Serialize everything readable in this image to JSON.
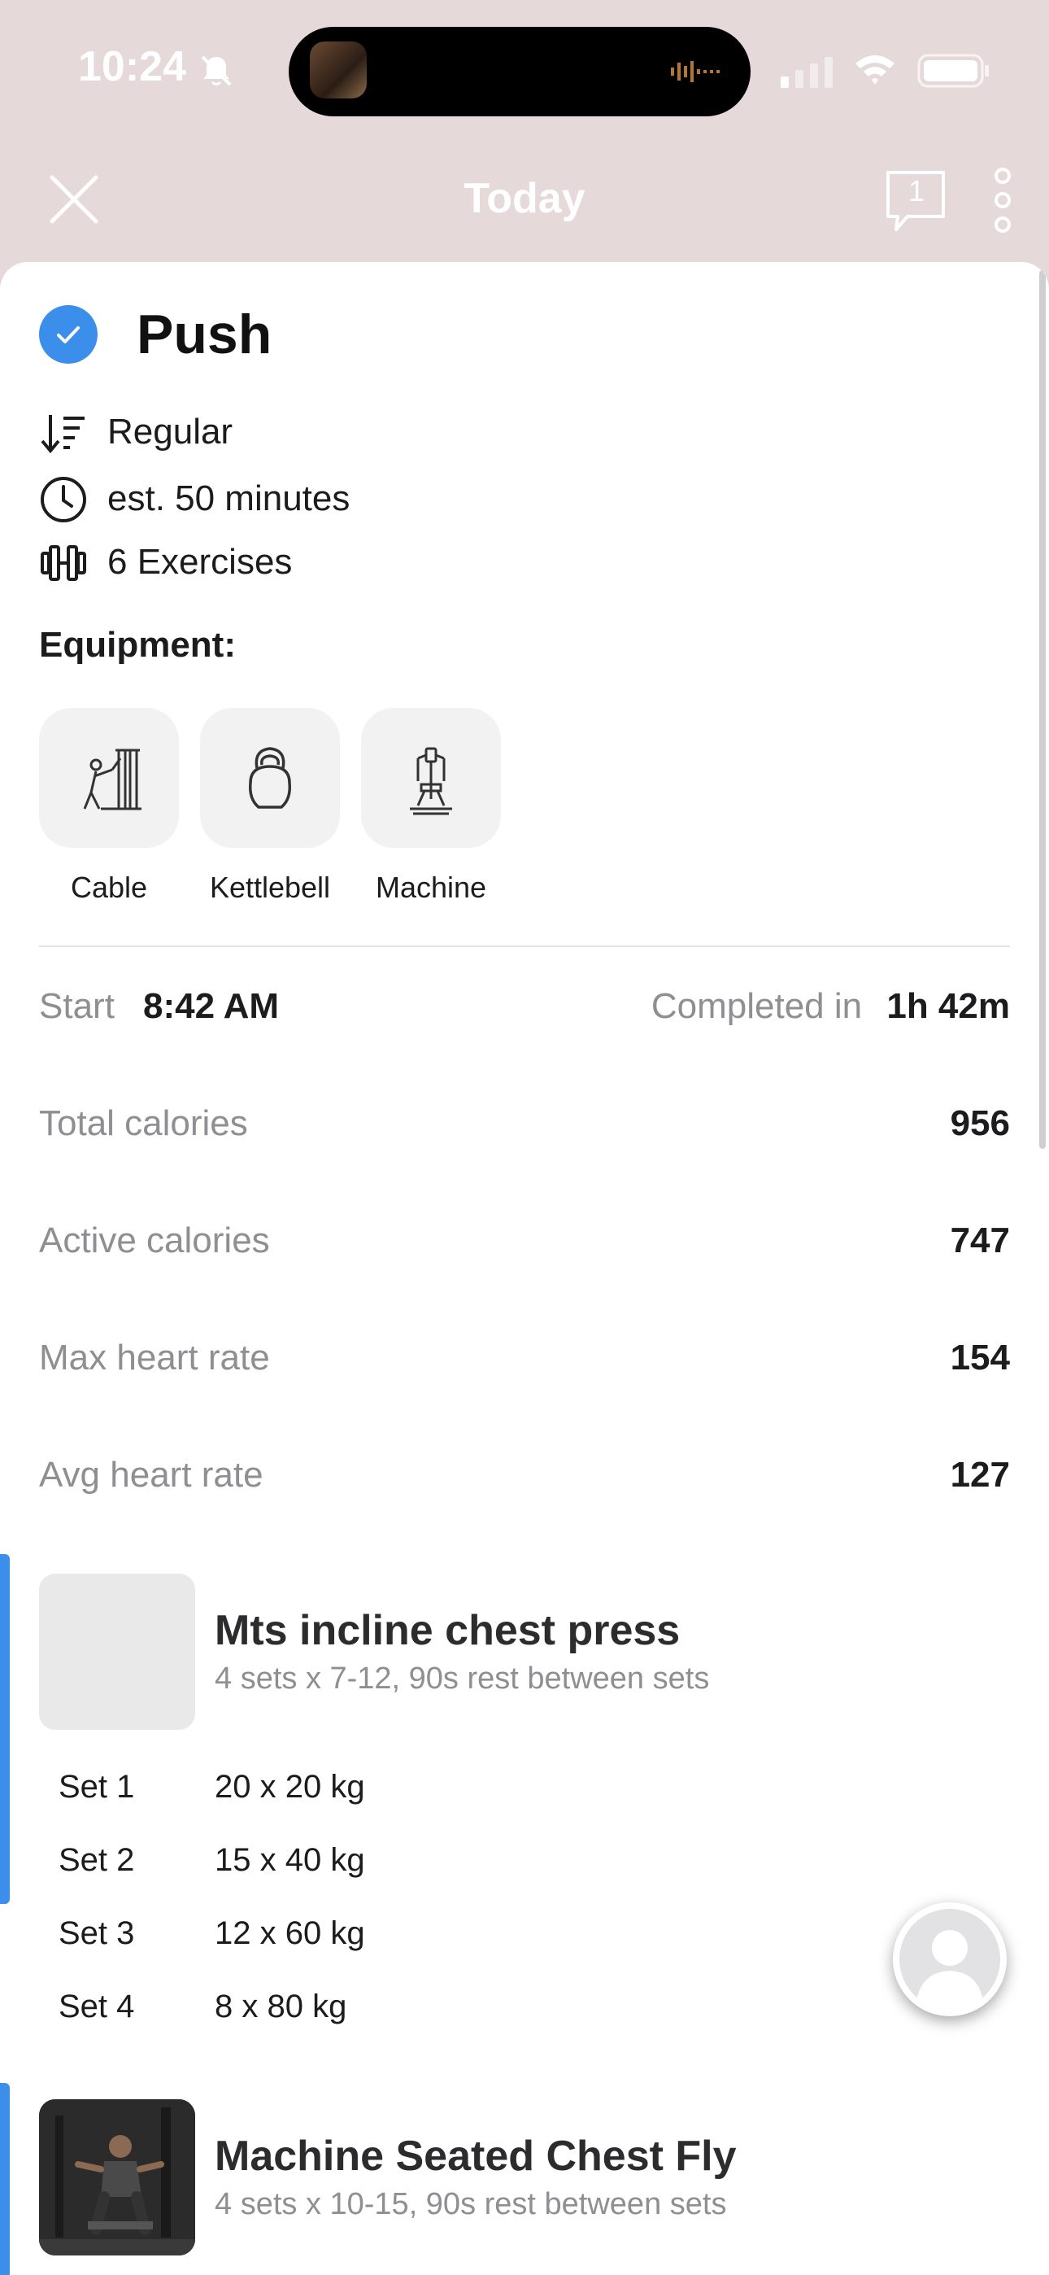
{
  "status_bar": {
    "time": "10:24",
    "icons": [
      "do-not-disturb-icon",
      "signal-icon",
      "wifi-icon",
      "battery-icon"
    ]
  },
  "header": {
    "title": "Today",
    "chat_count": "1",
    "icons": [
      "close-icon",
      "chat-icon",
      "more-icon"
    ]
  },
  "workout": {
    "title": "Push",
    "completed": true,
    "meta": [
      {
        "icon": "sort-icon",
        "text": "Regular"
      },
      {
        "icon": "clock-icon",
        "text": "est. 50 minutes"
      },
      {
        "icon": "dumbbell-icon",
        "text": "6 Exercises"
      }
    ],
    "equipment_heading": "Equipment:",
    "equipment": [
      {
        "icon": "cable-machine-icon",
        "label": "Cable"
      },
      {
        "icon": "kettlebell-icon",
        "label": "Kettlebell"
      },
      {
        "icon": "machine-icon",
        "label": "Machine"
      }
    ]
  },
  "summary": {
    "start_label": "Start",
    "start_value": "8:42 AM",
    "completed_label": "Completed in",
    "completed_value": "1h 42m",
    "stats": [
      {
        "label": "Total calories",
        "value": "956"
      },
      {
        "label": "Active calories",
        "value": "747"
      },
      {
        "label": "Max heart rate",
        "value": "154"
      },
      {
        "label": "Avg heart rate",
        "value": "127"
      }
    ]
  },
  "exercises": [
    {
      "name": "Mts incline chest press",
      "description": "4 sets x 7-12, 90s rest between sets",
      "sets": [
        {
          "label": "Set 1",
          "value": "20 x 20 kg"
        },
        {
          "label": "Set 2",
          "value": "15 x 40 kg"
        },
        {
          "label": "Set 3",
          "value": "12 x 60 kg"
        },
        {
          "label": "Set 4",
          "value": "8 x 80 kg"
        }
      ]
    },
    {
      "name": "Machine Seated Chest Fly",
      "description": "4 sets x 10-15, 90s rest between sets"
    }
  ],
  "colors": {
    "accent": "#3b8eea",
    "header_bg": "#e6d9d9",
    "muted_text": "#8e8e93"
  }
}
